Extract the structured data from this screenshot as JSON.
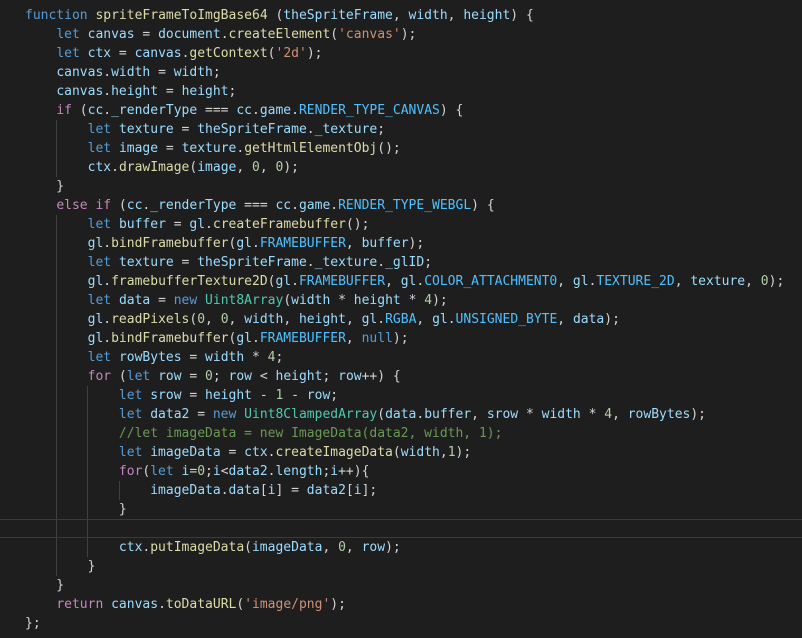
{
  "editor": {
    "lines": [
      [
        [
          "kw",
          "function"
        ],
        [
          "p",
          " "
        ],
        [
          "fn",
          "spriteFrameToImgBase64"
        ],
        [
          "p",
          " ("
        ],
        [
          "var",
          "theSpriteFrame"
        ],
        [
          "p",
          ", "
        ],
        [
          "var",
          "width"
        ],
        [
          "p",
          ", "
        ],
        [
          "var",
          "height"
        ],
        [
          "p",
          ") {"
        ]
      ],
      [
        [
          "p",
          "    "
        ],
        [
          "kw",
          "let"
        ],
        [
          "p",
          " "
        ],
        [
          "var",
          "canvas"
        ],
        [
          "p",
          " = "
        ],
        [
          "var",
          "document"
        ],
        [
          "p",
          "."
        ],
        [
          "fn",
          "createElement"
        ],
        [
          "p",
          "("
        ],
        [
          "str",
          "'canvas'"
        ],
        [
          "p",
          ");"
        ]
      ],
      [
        [
          "p",
          "    "
        ],
        [
          "kw",
          "let"
        ],
        [
          "p",
          " "
        ],
        [
          "var",
          "ctx"
        ],
        [
          "p",
          " = "
        ],
        [
          "var",
          "canvas"
        ],
        [
          "p",
          "."
        ],
        [
          "fn",
          "getContext"
        ],
        [
          "p",
          "("
        ],
        [
          "str",
          "'2d'"
        ],
        [
          "p",
          ");"
        ]
      ],
      [
        [
          "p",
          "    "
        ],
        [
          "var",
          "canvas"
        ],
        [
          "p",
          "."
        ],
        [
          "var",
          "width"
        ],
        [
          "p",
          " = "
        ],
        [
          "var",
          "width"
        ],
        [
          "p",
          ";"
        ]
      ],
      [
        [
          "p",
          "    "
        ],
        [
          "var",
          "canvas"
        ],
        [
          "p",
          "."
        ],
        [
          "var",
          "height"
        ],
        [
          "p",
          " = "
        ],
        [
          "var",
          "height"
        ],
        [
          "p",
          ";"
        ]
      ],
      [
        [
          "p",
          "    "
        ],
        [
          "ctl",
          "if"
        ],
        [
          "p",
          " ("
        ],
        [
          "var",
          "cc"
        ],
        [
          "p",
          "."
        ],
        [
          "var",
          "_renderType"
        ],
        [
          "p",
          " === "
        ],
        [
          "var",
          "cc"
        ],
        [
          "p",
          "."
        ],
        [
          "var",
          "game"
        ],
        [
          "p",
          "."
        ],
        [
          "const",
          "RENDER_TYPE_CANVAS"
        ],
        [
          "p",
          ") {"
        ]
      ],
      [
        [
          "p",
          "        "
        ],
        [
          "kw",
          "let"
        ],
        [
          "p",
          " "
        ],
        [
          "var",
          "texture"
        ],
        [
          "p",
          " = "
        ],
        [
          "var",
          "theSpriteFrame"
        ],
        [
          "p",
          "."
        ],
        [
          "var",
          "_texture"
        ],
        [
          "p",
          ";"
        ]
      ],
      [
        [
          "p",
          "        "
        ],
        [
          "kw",
          "let"
        ],
        [
          "p",
          " "
        ],
        [
          "var",
          "image"
        ],
        [
          "p",
          " = "
        ],
        [
          "var",
          "texture"
        ],
        [
          "p",
          "."
        ],
        [
          "fn",
          "getHtmlElementObj"
        ],
        [
          "p",
          "();"
        ]
      ],
      [
        [
          "p",
          "        "
        ],
        [
          "var",
          "ctx"
        ],
        [
          "p",
          "."
        ],
        [
          "fn",
          "drawImage"
        ],
        [
          "p",
          "("
        ],
        [
          "var",
          "image"
        ],
        [
          "p",
          ", "
        ],
        [
          "num",
          "0"
        ],
        [
          "p",
          ", "
        ],
        [
          "num",
          "0"
        ],
        [
          "p",
          ");"
        ]
      ],
      [
        [
          "p",
          "    }"
        ]
      ],
      [
        [
          "p",
          "    "
        ],
        [
          "ctl",
          "else"
        ],
        [
          "p",
          " "
        ],
        [
          "ctl",
          "if"
        ],
        [
          "p",
          " ("
        ],
        [
          "var",
          "cc"
        ],
        [
          "p",
          "."
        ],
        [
          "var",
          "_renderType"
        ],
        [
          "p",
          " === "
        ],
        [
          "var",
          "cc"
        ],
        [
          "p",
          "."
        ],
        [
          "var",
          "game"
        ],
        [
          "p",
          "."
        ],
        [
          "const",
          "RENDER_TYPE_WEBGL"
        ],
        [
          "p",
          ") {"
        ]
      ],
      [
        [
          "p",
          "        "
        ],
        [
          "kw",
          "let"
        ],
        [
          "p",
          " "
        ],
        [
          "var",
          "buffer"
        ],
        [
          "p",
          " = "
        ],
        [
          "var",
          "gl"
        ],
        [
          "p",
          "."
        ],
        [
          "fn",
          "createFramebuffer"
        ],
        [
          "p",
          "();"
        ]
      ],
      [
        [
          "p",
          "        "
        ],
        [
          "var",
          "gl"
        ],
        [
          "p",
          "."
        ],
        [
          "fn",
          "bindFramebuffer"
        ],
        [
          "p",
          "("
        ],
        [
          "var",
          "gl"
        ],
        [
          "p",
          "."
        ],
        [
          "const",
          "FRAMEBUFFER"
        ],
        [
          "p",
          ", "
        ],
        [
          "var",
          "buffer"
        ],
        [
          "p",
          ");"
        ]
      ],
      [
        [
          "p",
          "        "
        ],
        [
          "kw",
          "let"
        ],
        [
          "p",
          " "
        ],
        [
          "var",
          "texture"
        ],
        [
          "p",
          " = "
        ],
        [
          "var",
          "theSpriteFrame"
        ],
        [
          "p",
          "."
        ],
        [
          "var",
          "_texture"
        ],
        [
          "p",
          "."
        ],
        [
          "var",
          "_glID"
        ],
        [
          "p",
          ";"
        ]
      ],
      [
        [
          "p",
          "        "
        ],
        [
          "var",
          "gl"
        ],
        [
          "p",
          "."
        ],
        [
          "fn",
          "framebufferTexture2D"
        ],
        [
          "p",
          "("
        ],
        [
          "var",
          "gl"
        ],
        [
          "p",
          "."
        ],
        [
          "const",
          "FRAMEBUFFER"
        ],
        [
          "p",
          ", "
        ],
        [
          "var",
          "gl"
        ],
        [
          "p",
          "."
        ],
        [
          "const",
          "COLOR_ATTACHMENT0"
        ],
        [
          "p",
          ", "
        ],
        [
          "var",
          "gl"
        ],
        [
          "p",
          "."
        ],
        [
          "const",
          "TEXTURE_2D"
        ],
        [
          "p",
          ", "
        ],
        [
          "var",
          "texture"
        ],
        [
          "p",
          ", "
        ],
        [
          "num",
          "0"
        ],
        [
          "p",
          ");"
        ]
      ],
      [
        [
          "p",
          "        "
        ],
        [
          "kw",
          "let"
        ],
        [
          "p",
          " "
        ],
        [
          "var",
          "data"
        ],
        [
          "p",
          " = "
        ],
        [
          "kw",
          "new"
        ],
        [
          "p",
          " "
        ],
        [
          "cls",
          "Uint8Array"
        ],
        [
          "p",
          "("
        ],
        [
          "var",
          "width"
        ],
        [
          "p",
          " * "
        ],
        [
          "var",
          "height"
        ],
        [
          "p",
          " * "
        ],
        [
          "num",
          "4"
        ],
        [
          "p",
          ");"
        ]
      ],
      [
        [
          "p",
          "        "
        ],
        [
          "var",
          "gl"
        ],
        [
          "p",
          "."
        ],
        [
          "fn",
          "readPixels"
        ],
        [
          "p",
          "("
        ],
        [
          "num",
          "0"
        ],
        [
          "p",
          ", "
        ],
        [
          "num",
          "0"
        ],
        [
          "p",
          ", "
        ],
        [
          "var",
          "width"
        ],
        [
          "p",
          ", "
        ],
        [
          "var",
          "height"
        ],
        [
          "p",
          ", "
        ],
        [
          "var",
          "gl"
        ],
        [
          "p",
          "."
        ],
        [
          "const",
          "RGBA"
        ],
        [
          "p",
          ", "
        ],
        [
          "var",
          "gl"
        ],
        [
          "p",
          "."
        ],
        [
          "const",
          "UNSIGNED_BYTE"
        ],
        [
          "p",
          ", "
        ],
        [
          "var",
          "data"
        ],
        [
          "p",
          ");"
        ]
      ],
      [
        [
          "p",
          "        "
        ],
        [
          "var",
          "gl"
        ],
        [
          "p",
          "."
        ],
        [
          "fn",
          "bindFramebuffer"
        ],
        [
          "p",
          "("
        ],
        [
          "var",
          "gl"
        ],
        [
          "p",
          "."
        ],
        [
          "const",
          "FRAMEBUFFER"
        ],
        [
          "p",
          ", "
        ],
        [
          "kw",
          "null"
        ],
        [
          "p",
          ");"
        ]
      ],
      [
        [
          "p",
          "        "
        ],
        [
          "kw",
          "let"
        ],
        [
          "p",
          " "
        ],
        [
          "var",
          "rowBytes"
        ],
        [
          "p",
          " = "
        ],
        [
          "var",
          "width"
        ],
        [
          "p",
          " * "
        ],
        [
          "num",
          "4"
        ],
        [
          "p",
          ";"
        ]
      ],
      [
        [
          "p",
          "        "
        ],
        [
          "ctl",
          "for"
        ],
        [
          "p",
          " ("
        ],
        [
          "kw",
          "let"
        ],
        [
          "p",
          " "
        ],
        [
          "var",
          "row"
        ],
        [
          "p",
          " = "
        ],
        [
          "num",
          "0"
        ],
        [
          "p",
          "; "
        ],
        [
          "var",
          "row"
        ],
        [
          "p",
          " < "
        ],
        [
          "var",
          "height"
        ],
        [
          "p",
          "; "
        ],
        [
          "var",
          "row"
        ],
        [
          "p",
          "++) {"
        ]
      ],
      [
        [
          "p",
          "            "
        ],
        [
          "kw",
          "let"
        ],
        [
          "p",
          " "
        ],
        [
          "var",
          "srow"
        ],
        [
          "p",
          " = "
        ],
        [
          "var",
          "height"
        ],
        [
          "p",
          " - "
        ],
        [
          "num",
          "1"
        ],
        [
          "p",
          " - "
        ],
        [
          "var",
          "row"
        ],
        [
          "p",
          ";"
        ]
      ],
      [
        [
          "p",
          "            "
        ],
        [
          "kw",
          "let"
        ],
        [
          "p",
          " "
        ],
        [
          "var",
          "data2"
        ],
        [
          "p",
          " = "
        ],
        [
          "kw",
          "new"
        ],
        [
          "p",
          " "
        ],
        [
          "cls",
          "Uint8ClampedArray"
        ],
        [
          "p",
          "("
        ],
        [
          "var",
          "data"
        ],
        [
          "p",
          "."
        ],
        [
          "var",
          "buffer"
        ],
        [
          "p",
          ", "
        ],
        [
          "var",
          "srow"
        ],
        [
          "p",
          " * "
        ],
        [
          "var",
          "width"
        ],
        [
          "p",
          " * "
        ],
        [
          "num",
          "4"
        ],
        [
          "p",
          ", "
        ],
        [
          "var",
          "rowBytes"
        ],
        [
          "p",
          ");"
        ]
      ],
      [
        [
          "p",
          "            "
        ],
        [
          "cmt",
          "//let imageData = new ImageData(data2, width, 1);"
        ]
      ],
      [
        [
          "p",
          "            "
        ],
        [
          "kw",
          "let"
        ],
        [
          "p",
          " "
        ],
        [
          "var",
          "imageData"
        ],
        [
          "p",
          " = "
        ],
        [
          "var",
          "ctx"
        ],
        [
          "p",
          "."
        ],
        [
          "fn",
          "createImageData"
        ],
        [
          "p",
          "("
        ],
        [
          "var",
          "width"
        ],
        [
          "p",
          ","
        ],
        [
          "num",
          "1"
        ],
        [
          "p",
          ");"
        ]
      ],
      [
        [
          "p",
          "            "
        ],
        [
          "ctl",
          "for"
        ],
        [
          "p",
          "("
        ],
        [
          "kw",
          "let"
        ],
        [
          "p",
          " "
        ],
        [
          "var",
          "i"
        ],
        [
          "p",
          "="
        ],
        [
          "num",
          "0"
        ],
        [
          "p",
          ";"
        ],
        [
          "var",
          "i"
        ],
        [
          "p",
          "<"
        ],
        [
          "var",
          "data2"
        ],
        [
          "p",
          "."
        ],
        [
          "var",
          "length"
        ],
        [
          "p",
          ";"
        ],
        [
          "var",
          "i"
        ],
        [
          "p",
          "++){"
        ]
      ],
      [
        [
          "p",
          "                "
        ],
        [
          "var",
          "imageData"
        ],
        [
          "p",
          "."
        ],
        [
          "var",
          "data"
        ],
        [
          "p",
          "["
        ],
        [
          "var",
          "i"
        ],
        [
          "p",
          "] = "
        ],
        [
          "var",
          "data2"
        ],
        [
          "p",
          "["
        ],
        [
          "var",
          "i"
        ],
        [
          "p",
          "];"
        ]
      ],
      [
        [
          "p",
          "            }"
        ]
      ],
      [
        [
          "p",
          ""
        ]
      ],
      [
        [
          "p",
          "            "
        ],
        [
          "var",
          "ctx"
        ],
        [
          "p",
          "."
        ],
        [
          "fn",
          "putImageData"
        ],
        [
          "p",
          "("
        ],
        [
          "var",
          "imageData"
        ],
        [
          "p",
          ", "
        ],
        [
          "num",
          "0"
        ],
        [
          "p",
          ", "
        ],
        [
          "var",
          "row"
        ],
        [
          "p",
          ");"
        ]
      ],
      [
        [
          "p",
          "        }"
        ]
      ],
      [
        [
          "p",
          "    }"
        ]
      ],
      [
        [
          "p",
          "    "
        ],
        [
          "ctl",
          "return"
        ],
        [
          "p",
          " "
        ],
        [
          "var",
          "canvas"
        ],
        [
          "p",
          "."
        ],
        [
          "fn",
          "toDataURL"
        ],
        [
          "p",
          "("
        ],
        [
          "str",
          "'image/png'"
        ],
        [
          "p",
          ");"
        ]
      ],
      [
        [
          "p",
          "};"
        ]
      ]
    ],
    "current_line": 28
  }
}
